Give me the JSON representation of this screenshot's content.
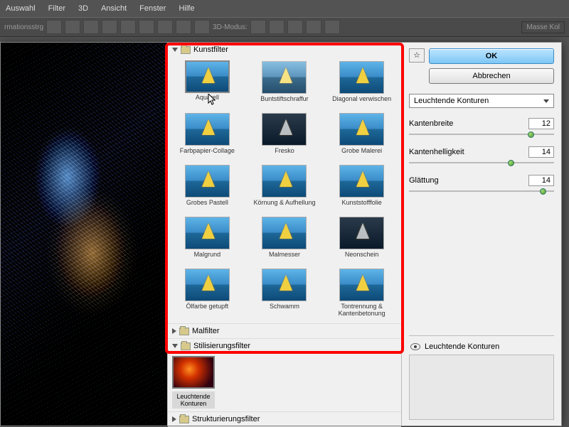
{
  "menu": {
    "items": [
      "Auswahl",
      "Filter",
      "3D",
      "Ansicht",
      "Fenster",
      "Hilfe"
    ]
  },
  "toolbar": {
    "label_3d": "3D-Modus:",
    "label_left": "rmationsstrg",
    "right_panel": "Masse Kol"
  },
  "categories": {
    "kunst": {
      "title": "Kunstfilter",
      "filters": [
        "Aquarell",
        "Buntstiftschraffur",
        "Diagonal verwischen",
        "Farbpapier-Collage",
        "Fresko",
        "Grobe Malerei",
        "Grobes Pastell",
        "Körnung & Aufhellung",
        "Kunststofffolie",
        "Malgrund",
        "Malmesser",
        "Neonschein",
        "Ölfarbe getupft",
        "Schwamm",
        "Tontrennung & Kantenbetonung"
      ]
    },
    "mal": {
      "title": "Malfilter"
    },
    "stil": {
      "title": "Stilisierungsfilter",
      "selected_label": "Leuchtende Konturen"
    },
    "struk": {
      "title": "Strukturierungsfilter"
    }
  },
  "buttons": {
    "ok": "OK",
    "cancel": "Abbrechen",
    "expand": "☆"
  },
  "dropdown": {
    "value": "Leuchtende Konturen"
  },
  "params": {
    "p1": {
      "label": "Kantenbreite",
      "value": "12",
      "pos": 82
    },
    "p2": {
      "label": "Kantenhelligkeit",
      "value": "14",
      "pos": 68
    },
    "p3": {
      "label": "Glättung",
      "value": "14",
      "pos": 90
    }
  },
  "layer": {
    "name": "Leuchtende Konturen"
  }
}
